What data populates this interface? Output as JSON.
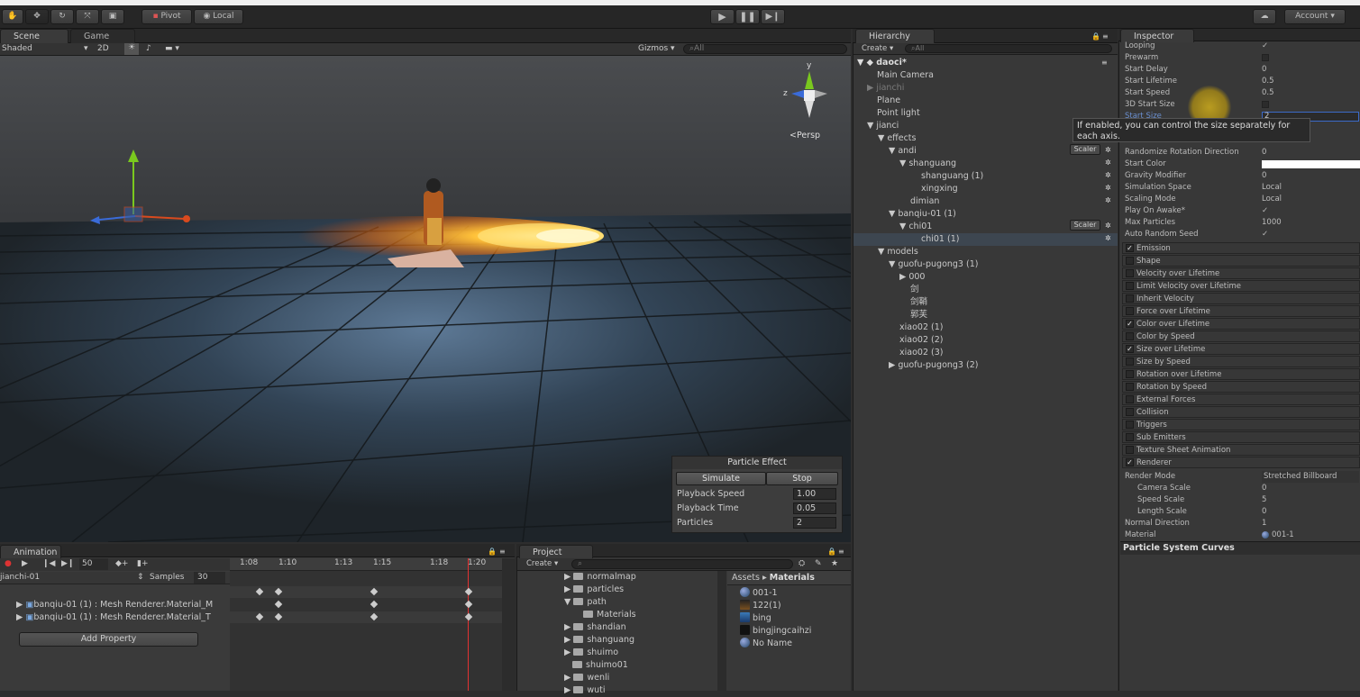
{
  "toolbar": {
    "pivot": "Pivot",
    "local": "Local",
    "account": "Account"
  },
  "scene": {
    "tab_scene": "Scene",
    "tab_game": "Game",
    "shading_mode": "Shaded",
    "mode_2d": "2D",
    "gizmos": "Gizmos",
    "search_placeholder": "All",
    "persp_label": "Persp",
    "axis_y": "y",
    "axis_z": "z"
  },
  "hierarchy": {
    "title": "Hierarchy",
    "create": "Create",
    "search_placeholder": "All",
    "scene_name": "daoci*",
    "items": [
      {
        "label": "Main Camera"
      },
      {
        "label": "jianchi"
      },
      {
        "label": "Plane"
      },
      {
        "label": "Point light"
      },
      {
        "label": "jianci"
      },
      {
        "label": "effects"
      },
      {
        "label": "andi"
      },
      {
        "label": "shanguang"
      },
      {
        "label": "shanguang (1)"
      },
      {
        "label": "xingxing"
      },
      {
        "label": "dimian"
      },
      {
        "label": "banqiu-01 (1)"
      },
      {
        "label": "chi01"
      },
      {
        "label": "chi01 (1)"
      },
      {
        "label": "models"
      },
      {
        "label": "guofu-pugong3 (1)"
      },
      {
        "label": "000"
      },
      {
        "label": "剑"
      },
      {
        "label": "剑鞘"
      },
      {
        "label": "郭芙"
      },
      {
        "label": "xiao02 (1)"
      },
      {
        "label": "xiao02 (2)"
      },
      {
        "label": "xiao02 (3)"
      },
      {
        "label": "guofu-pugong3 (2)"
      }
    ],
    "scaler_label": "Scaler"
  },
  "inspector": {
    "title": "Inspector",
    "props_top": [
      {
        "label": "Looping",
        "value": "✓"
      },
      {
        "label": "Prewarm",
        "value": ""
      },
      {
        "label": "Start Delay",
        "value": "0"
      },
      {
        "label": "Start Lifetime",
        "value": "0.5"
      },
      {
        "label": "Start Speed",
        "value": "0.5"
      },
      {
        "label": "3D Start Size",
        "value": ""
      },
      {
        "label": "Start Size",
        "value": "2"
      }
    ],
    "tooltip": "If enabled, you can control the size separately for each axis.",
    "props_mid": [
      {
        "label": "Randomize Rotation Direction",
        "value": "0"
      },
      {
        "label": "Start Color",
        "value": ""
      },
      {
        "label": "Gravity Modifier",
        "value": "0"
      },
      {
        "label": "Simulation Space",
        "value": "Local"
      },
      {
        "label": "Scaling Mode",
        "value": "Local"
      },
      {
        "label": "Play On Awake*",
        "value": "✓"
      },
      {
        "label": "Max Particles",
        "value": "1000"
      },
      {
        "label": "Auto Random Seed",
        "value": "✓"
      }
    ],
    "modules": [
      {
        "label": "Emission",
        "checked": "✓"
      },
      {
        "label": "Shape",
        "checked": ""
      },
      {
        "label": "Velocity over Lifetime",
        "checked": ""
      },
      {
        "label": "Limit Velocity over Lifetime",
        "checked": ""
      },
      {
        "label": "Inherit Velocity",
        "checked": ""
      },
      {
        "label": "Force over Lifetime",
        "checked": ""
      },
      {
        "label": "Color over Lifetime",
        "checked": "✓"
      },
      {
        "label": "Color by Speed",
        "checked": ""
      },
      {
        "label": "Size over Lifetime",
        "checked": "✓"
      },
      {
        "label": "Size by Speed",
        "checked": ""
      },
      {
        "label": "Rotation over Lifetime",
        "checked": ""
      },
      {
        "label": "Rotation by Speed",
        "checked": ""
      },
      {
        "label": "External Forces",
        "checked": ""
      },
      {
        "label": "Collision",
        "checked": ""
      },
      {
        "label": "Triggers",
        "checked": ""
      },
      {
        "label": "Sub Emitters",
        "checked": ""
      },
      {
        "label": "Texture Sheet Animation",
        "checked": ""
      },
      {
        "label": "Renderer",
        "checked": "✓"
      }
    ],
    "renderer_props": [
      {
        "label": "Render Mode",
        "value": "Stretched Billboard"
      },
      {
        "label": "Camera Scale",
        "value": "0"
      },
      {
        "label": "Speed Scale",
        "value": "5"
      },
      {
        "label": "Length Scale",
        "value": "0"
      },
      {
        "label": "Normal Direction",
        "value": "1"
      },
      {
        "label": "Material",
        "value": "001-1"
      }
    ],
    "curves_title": "Particle System Curves"
  },
  "particle_effect": {
    "title": "Particle Effect",
    "simulate": "Simulate",
    "stop": "Stop",
    "rows": [
      {
        "label": "Playback Speed",
        "value": "1.00"
      },
      {
        "label": "Playback Time",
        "value": "0.05"
      },
      {
        "label": "Particles",
        "value": "2"
      }
    ]
  },
  "animation": {
    "title": "Animation",
    "frame": "50",
    "clip": "jianchi-01",
    "samples_label": "Samples",
    "samples": "30",
    "ticks": [
      "1:08",
      "1:10",
      "1:13",
      "1:15",
      "1:18",
      "1:20"
    ],
    "tracks": [
      "banqiu-01 (1) : Mesh Renderer.Material_M",
      "banqiu-01 (1) : Mesh Renderer.Material_T"
    ],
    "add_property": "Add Property"
  },
  "project": {
    "title": "Project",
    "create": "Create",
    "folders": [
      "normalmap",
      "particles",
      "path",
      "Materials",
      "shandian",
      "shanguang",
      "shuimo",
      "shuimo01",
      "wenli",
      "wuti"
    ],
    "breadcrumb_root": "Assets",
    "breadcrumb_leaf": "Materials",
    "assets": [
      "001-1",
      "122(1)",
      "bing",
      "bingjingcaihzi",
      "No Name"
    ]
  }
}
